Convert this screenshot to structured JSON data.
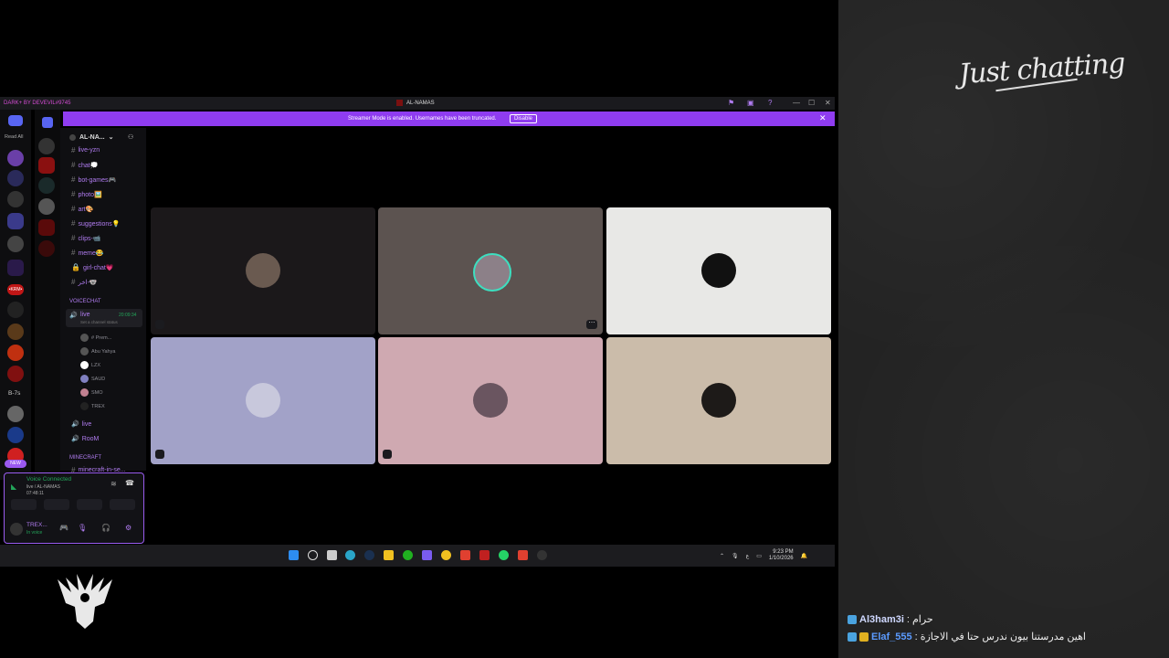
{
  "overlay": {
    "title": "Just chatting",
    "chat": [
      {
        "user": "Al3ham3i",
        "message": "حرام"
      },
      {
        "user": "Elaf_555",
        "message": "اهين مدرستنا بيون ندرس حتا في الاجازة"
      }
    ]
  },
  "window": {
    "brand": "DARK+ BY DEVEVIL#9745",
    "server_name": "AL-NAMAS",
    "controls": [
      "—",
      "☐",
      "✕"
    ]
  },
  "streamer_banner": {
    "message": "Streamer Mode is enabled. Usernames have been truncated.",
    "button": "Disable",
    "close": "✕"
  },
  "rail": {
    "read_all": "Read All",
    "new_badge": "NEW",
    "b7s": "B-7s",
    "krm": "•KRM•"
  },
  "sidebar": {
    "server_title": "AL-NA...",
    "channels": [
      {
        "name": "live-yzn",
        "icon": "#"
      },
      {
        "name": "chat💭",
        "icon": "#"
      },
      {
        "name": "bot-games🎮",
        "icon": "#"
      },
      {
        "name": "photo🖼️",
        "icon": "#"
      },
      {
        "name": "art🎨",
        "icon": "#"
      },
      {
        "name": "suggestions💡",
        "icon": "#"
      },
      {
        "name": "clips-📹",
        "icon": "#"
      },
      {
        "name": "meme😂",
        "icon": "#"
      },
      {
        "name": "girl-chat💗",
        "icon": "🔒"
      },
      {
        "name": "اخر-🐨",
        "icon": "#"
      }
    ],
    "voice_category": "VOICECHAT",
    "live_channel": {
      "name": "live",
      "timer": "20:09:34",
      "status": "Set a channel status"
    },
    "voice_users": [
      "# Prem...",
      "Abu Yahya",
      "LZX",
      "SAUD",
      "SMO",
      "TREX"
    ],
    "extra_voice": [
      "live",
      "RooM"
    ],
    "mc_category": "MINECRAFT",
    "mc_channel": "minecraft-in-se..."
  },
  "voice_panel": {
    "status": "Voice Connected",
    "channel": "live / AL-NAMAS",
    "time": "07:48:11",
    "user": "TREX...",
    "user_status": "In voice"
  },
  "taskbar": {
    "time": "9:23 PM",
    "date": "1/10/2026",
    "lang": "ع"
  },
  "colors": {
    "accent": "#8f3cf0",
    "voice_green": "#23a55a",
    "channel": "#b07cf0"
  },
  "tiles": [
    {
      "bg": "#1b181a"
    },
    {
      "bg": "#5c5350"
    },
    {
      "bg": "#e8e8e6"
    },
    {
      "bg": "#a2a2c8"
    },
    {
      "bg": "#cfa9b1"
    },
    {
      "bg": "#cbbcaa"
    }
  ]
}
